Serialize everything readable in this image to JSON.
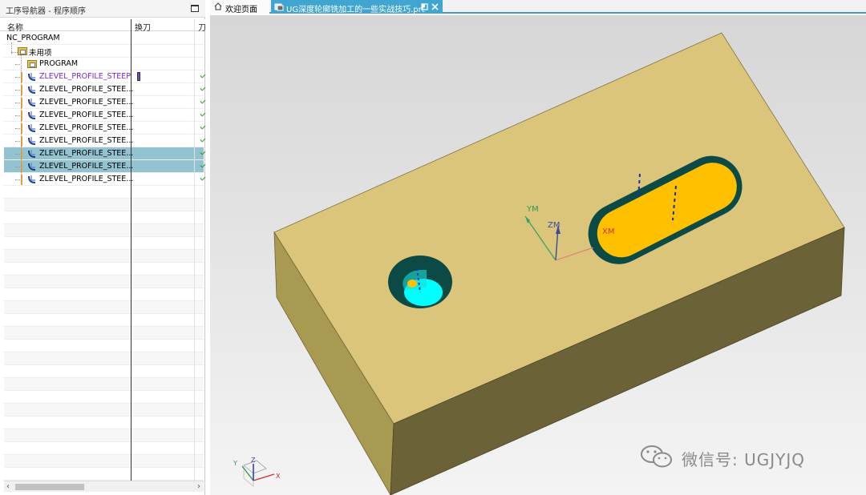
{
  "navigator": {
    "title": "工序导航器 - 程序顺序",
    "columns": {
      "name": "名称",
      "tool_change": "换刀",
      "path": "刀"
    },
    "root": "NC_PROGRAM",
    "unused": "未用项",
    "program": "PROGRAM",
    "operations": [
      {
        "name": "ZLEVEL_PROFILE_STEEP",
        "state": "active",
        "tool_change": true,
        "selected": false
      },
      {
        "name": "ZLEVEL_PROFILE_STEE...",
        "state": "normal",
        "tool_change": false,
        "selected": false
      },
      {
        "name": "ZLEVEL_PROFILE_STEE...",
        "state": "normal",
        "tool_change": false,
        "selected": false
      },
      {
        "name": "ZLEVEL_PROFILE_STEE...",
        "state": "normal",
        "tool_change": false,
        "selected": false
      },
      {
        "name": "ZLEVEL_PROFILE_STEE...",
        "state": "normal",
        "tool_change": false,
        "selected": false
      },
      {
        "name": "ZLEVEL_PROFILE_STEE...",
        "state": "normal",
        "tool_change": false,
        "selected": false
      },
      {
        "name": "ZLEVEL_PROFILE_STEE...",
        "state": "normal",
        "tool_change": false,
        "selected": true
      },
      {
        "name": "ZLEVEL_PROFILE_STEE...",
        "state": "normal",
        "tool_change": false,
        "selected": true
      },
      {
        "name": "ZLEVEL_PROFILE_STEE...",
        "state": "normal",
        "tool_change": false,
        "selected": false
      }
    ],
    "scroll_left": "‹",
    "scroll_right": "›"
  },
  "tabs": [
    {
      "label": "欢迎页面",
      "icon": "home-icon",
      "active": false
    },
    {
      "label": "UG深度轮廓铣加工的一些实战技巧.prt",
      "icon": "part-icon",
      "active": true
    }
  ],
  "viewport": {
    "axes_labels": {
      "ym": "YM",
      "zm": "ZM",
      "xm": "XM"
    },
    "triad_labels": {
      "x": "X",
      "y": "Y",
      "z": "Z"
    },
    "watermark": "微信号: UGJYJQ"
  },
  "colors": {
    "accent": "#41a6cf",
    "selection": "#93c3d1",
    "block_top": "#d8c273",
    "block_front": "#a99a52",
    "block_side": "#6b6238",
    "slot_floor": "#ffc000",
    "pocket_wall": "#0b4a45",
    "hole_floor": "#00ffff",
    "active_op": "#7a2bd0"
  }
}
